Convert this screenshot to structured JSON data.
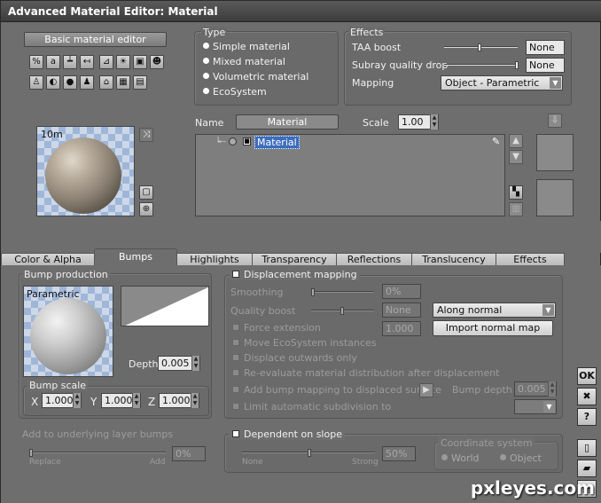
{
  "window": {
    "title": "Advanced Material Editor: Material"
  },
  "basic_editor_button": "Basic material editor",
  "type_group": {
    "label": "Type",
    "options": [
      "Simple material",
      "Mixed material",
      "Volumetric material",
      "EcoSystem"
    ],
    "selected": 0
  },
  "effects_group": {
    "label": "Effects",
    "taa_boost": {
      "label": "TAA boost",
      "value": "None"
    },
    "subray": {
      "label": "Subray quality drop",
      "value": "None"
    },
    "mapping": {
      "label": "Mapping",
      "value": "Object - Parametric"
    }
  },
  "preview": {
    "distance": "10m"
  },
  "material": {
    "name_label": "Name",
    "name_value": "Material",
    "scale_label": "Scale",
    "scale_value": "1.00",
    "tree_item": "Material"
  },
  "tabs": [
    {
      "label": "Color & Alpha"
    },
    {
      "label": "Bumps"
    },
    {
      "label": "Highlights"
    },
    {
      "label": "Transparency"
    },
    {
      "label": "Reflections"
    },
    {
      "label": "Translucency"
    },
    {
      "label": "Effects"
    }
  ],
  "bump_production": {
    "label": "Bump production",
    "type": "Parametric",
    "depth_label": "Depth",
    "depth_value": "0.005"
  },
  "bump_scale": {
    "label": "Bump scale",
    "x_label": "X",
    "x": "1.000",
    "y_label": "Y",
    "y": "1.000",
    "z_label": "Z",
    "z": "1.000"
  },
  "displacement": {
    "label": "Displacement mapping",
    "smoothing_label": "Smoothing",
    "smoothing_value": "0%",
    "quality_boost_label": "Quality boost",
    "quality_boost_value": "None",
    "force_extension_label": "Force extension",
    "force_extension_value": "1.000",
    "move_eco_label": "Move EcoSystem instances",
    "displace_outwards_label": "Displace outwards only",
    "reevaluate_label": "Re-evaluate material distribution after displacement",
    "add_bump_label": "Add bump mapping to displaced surface",
    "bump_depth_label": "Bump depth",
    "bump_depth_value": "0.005",
    "limit_label": "Limit automatic subdivision to",
    "direction_value": "Along normal",
    "import_button": "Import normal map"
  },
  "underlying": {
    "label": "Add to underlying layer bumps",
    "replace_label": "Replace",
    "add_label": "Add",
    "value": "0%"
  },
  "slope": {
    "label": "Dependent on slope",
    "none_label": "None",
    "strong_label": "Strong",
    "value": "50%",
    "coord_label": "Coordinate system",
    "world_label": "World",
    "object_label": "Object"
  },
  "side_buttons": {
    "ok": "OK",
    "cancel": "✖",
    "help": "?"
  },
  "watermark": "pxleyes.com"
}
